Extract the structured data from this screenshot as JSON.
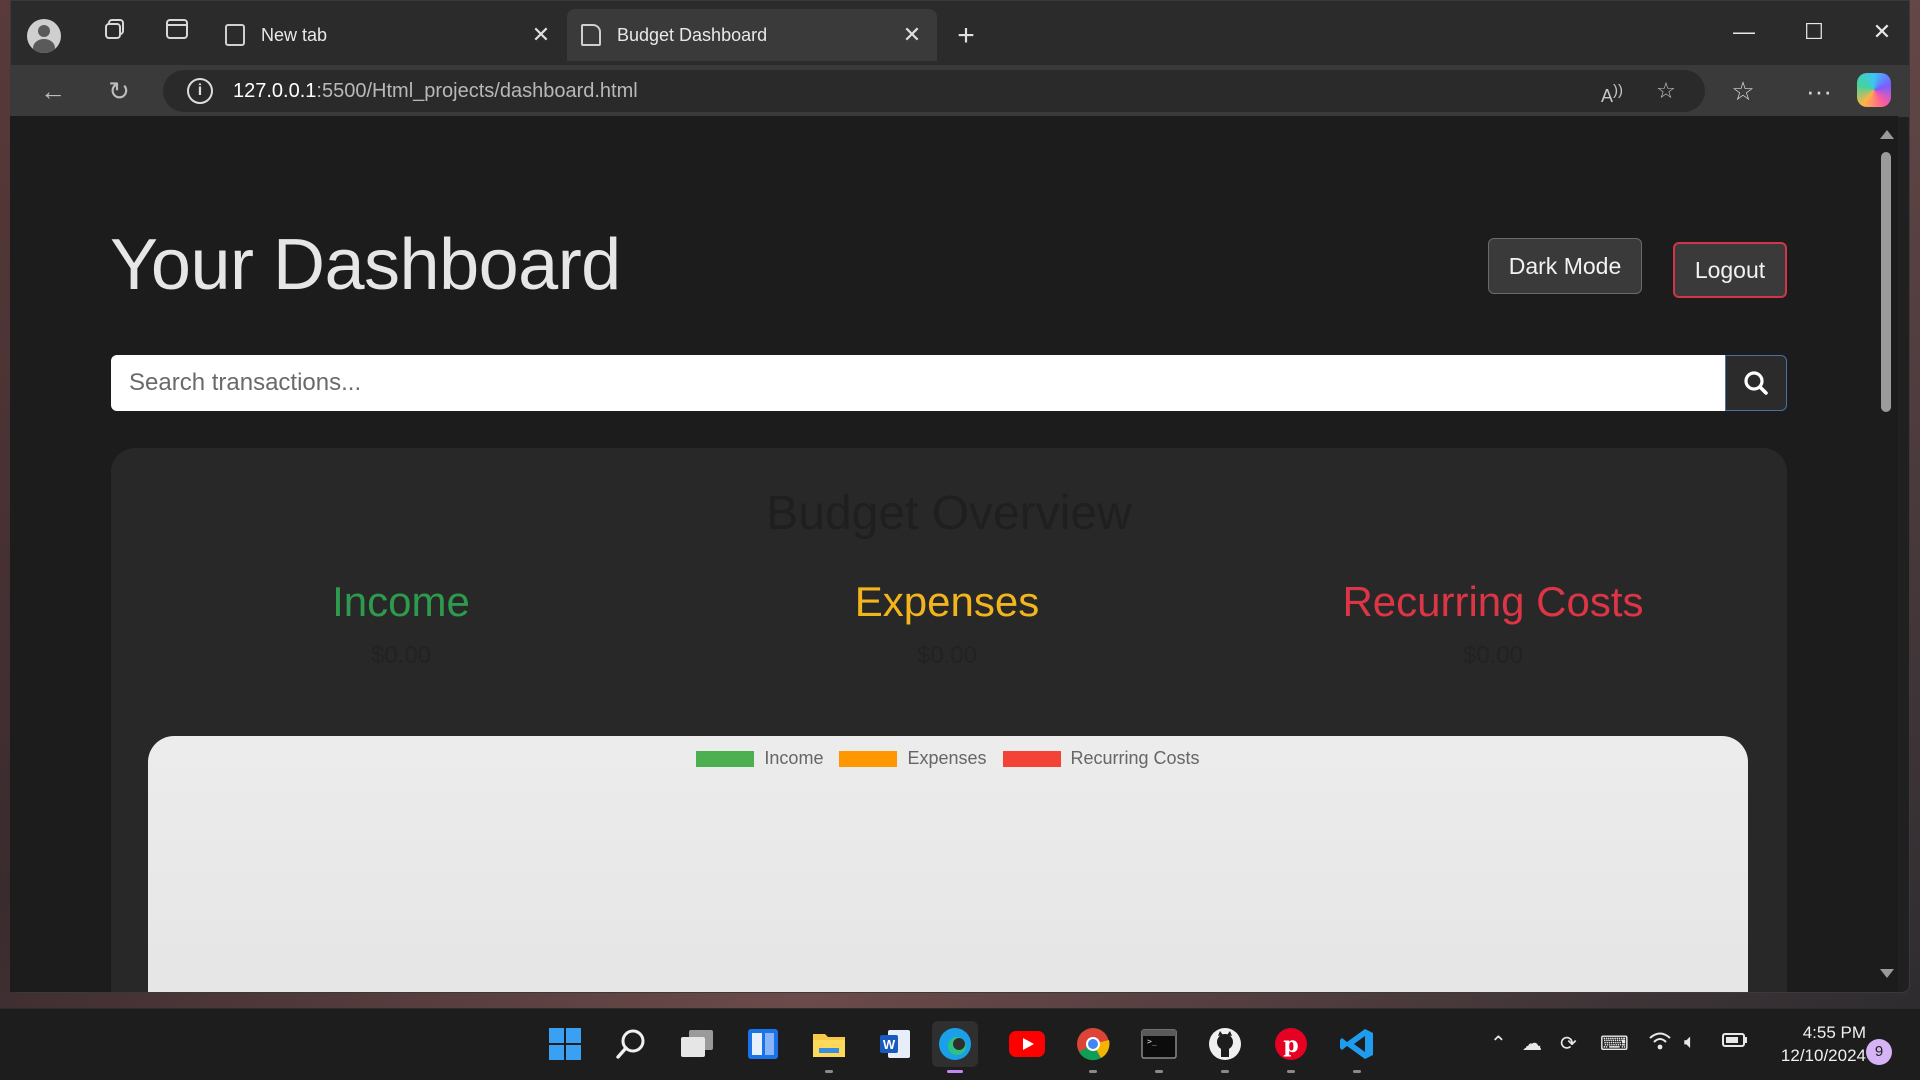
{
  "browser": {
    "tabs": [
      {
        "label": "New tab"
      },
      {
        "label": "Budget Dashboard"
      }
    ],
    "address": {
      "host": "127.0.0.1",
      "path": ":5500/Html_projects/dashboard.html"
    }
  },
  "page": {
    "title": "Your Dashboard",
    "dark_mode_label": "Dark Mode",
    "logout_label": "Logout",
    "search": {
      "placeholder": "Search transactions..."
    },
    "overview": {
      "title": "Budget Overview",
      "stats": [
        {
          "label": "Income",
          "amount": "$0.00",
          "color": "#2e9a4d"
        },
        {
          "label": "Expenses",
          "amount": "$0.00",
          "color": "#f2b51c"
        },
        {
          "label": "Recurring Costs",
          "amount": "$0.00",
          "color": "#dc3545"
        }
      ]
    },
    "chart_legend": [
      {
        "label": "Income",
        "color": "#4caf50"
      },
      {
        "label": "Expenses",
        "color": "#ff9800"
      },
      {
        "label": "Recurring Costs",
        "color": "#f44336"
      }
    ]
  },
  "taskbar": {
    "apps": [
      "start-icon",
      "search-icon",
      "task-view-icon",
      "widgets-icon",
      "file-explorer-icon",
      "word-icon",
      "edge-icon",
      "youtube-icon",
      "chrome-icon",
      "terminal-icon",
      "github-icon",
      "pinterest-icon",
      "vscode-icon"
    ],
    "time": "4:55 PM",
    "date": "12/10/2024",
    "notification_count": "9"
  }
}
